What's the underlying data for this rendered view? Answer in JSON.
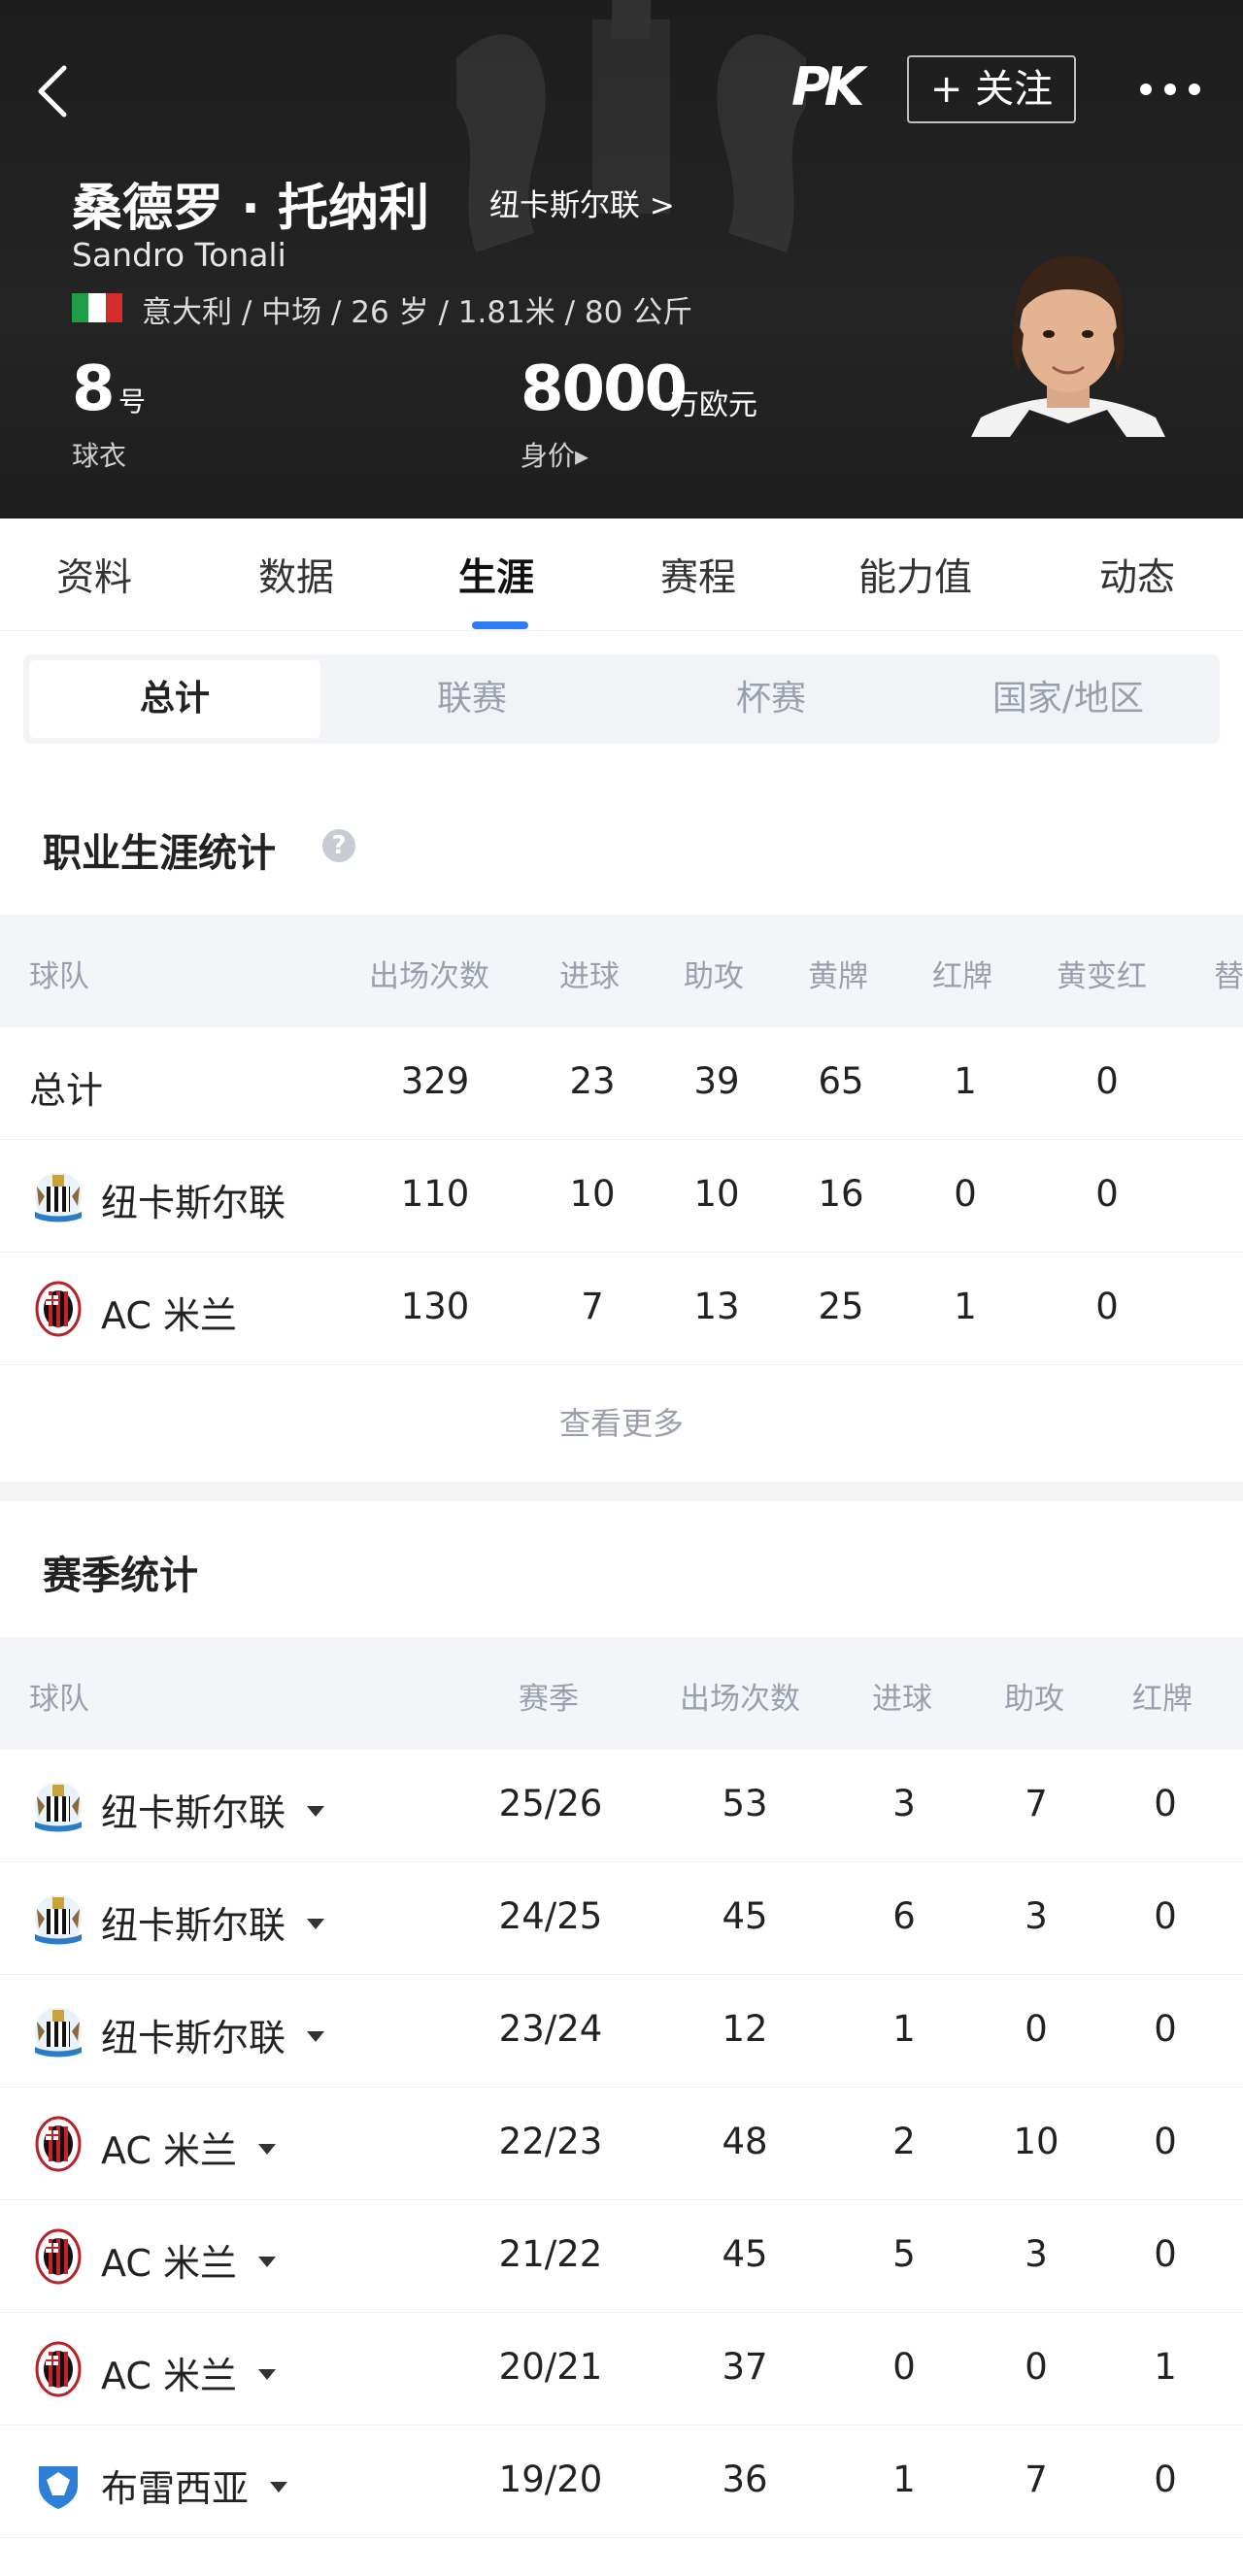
{
  "header": {
    "pk_logo": "PK",
    "follow_label": "+ 关注",
    "name_cn": "桑德罗 · 托纳利",
    "club_link": "纽卡斯尔联 >",
    "name_en": "Sandro Tonali",
    "info": "意大利 / 中场 / 26 岁 / 1.81米 / 80 公斤",
    "jersey_number": "8",
    "jersey_unit": "号",
    "jersey_label": "球衣",
    "market_value": "8000",
    "market_value_unit": "万欧元",
    "market_value_label": "身价▸",
    "flag_colors": [
      "#1f9e48",
      "#ffffff",
      "#d62b2b"
    ]
  },
  "tabs": [
    "资料",
    "数据",
    "生涯",
    "赛程",
    "能力值",
    "动态"
  ],
  "active_tab": "生涯",
  "segments": [
    "总计",
    "联赛",
    "杯赛",
    "国家/地区"
  ],
  "active_segment": "总计",
  "career": {
    "title": "职业生涯统计",
    "help_icon": "?",
    "columns": [
      "球队",
      "出场次数",
      "进球",
      "助攻",
      "黄牌",
      "红牌",
      "黄变红",
      "替"
    ],
    "rows": [
      {
        "team": "总计",
        "apps": "329",
        "goals": "23",
        "assists": "39",
        "yellow": "65",
        "red": "1",
        "second_yellow": "0"
      },
      {
        "team": "纽卡斯尔联",
        "apps": "110",
        "goals": "10",
        "assists": "10",
        "yellow": "16",
        "red": "0",
        "second_yellow": "0"
      },
      {
        "team": "AC 米兰",
        "apps": "130",
        "goals": "7",
        "assists": "13",
        "yellow": "25",
        "red": "1",
        "second_yellow": "0"
      }
    ],
    "see_more": "查看更多"
  },
  "season": {
    "title": "赛季统计",
    "columns": [
      "球队",
      "赛季",
      "出场次数",
      "进球",
      "助攻",
      "红牌"
    ],
    "rows": [
      {
        "team": "纽卡斯尔联",
        "season": "25/26",
        "apps": "53",
        "goals": "3",
        "assists": "7",
        "red": "0"
      },
      {
        "team": "纽卡斯尔联",
        "season": "24/25",
        "apps": "45",
        "goals": "6",
        "assists": "3",
        "red": "0"
      },
      {
        "team": "纽卡斯尔联",
        "season": "23/24",
        "apps": "12",
        "goals": "1",
        "assists": "0",
        "red": "0"
      },
      {
        "team": "AC 米兰",
        "season": "22/23",
        "apps": "48",
        "goals": "2",
        "assists": "10",
        "red": "0"
      },
      {
        "team": "AC 米兰",
        "season": "21/22",
        "apps": "45",
        "goals": "5",
        "assists": "3",
        "red": "0"
      },
      {
        "team": "AC 米兰",
        "season": "20/21",
        "apps": "37",
        "goals": "0",
        "assists": "0",
        "red": "1"
      },
      {
        "team": "布雷西亚",
        "season": "19/20",
        "apps": "36",
        "goals": "1",
        "assists": "7",
        "red": "0"
      }
    ]
  },
  "colors": {
    "accent": "#2f7df6",
    "header_bg": "#1e1e1e",
    "muted": "#9aa0ab"
  },
  "icons": {
    "back": "chevron-left-icon",
    "more": "more-icon",
    "newcastle": "newcastle-crest-icon",
    "milan": "ac-milan-crest-icon",
    "brescia": "brescia-crest-icon"
  }
}
